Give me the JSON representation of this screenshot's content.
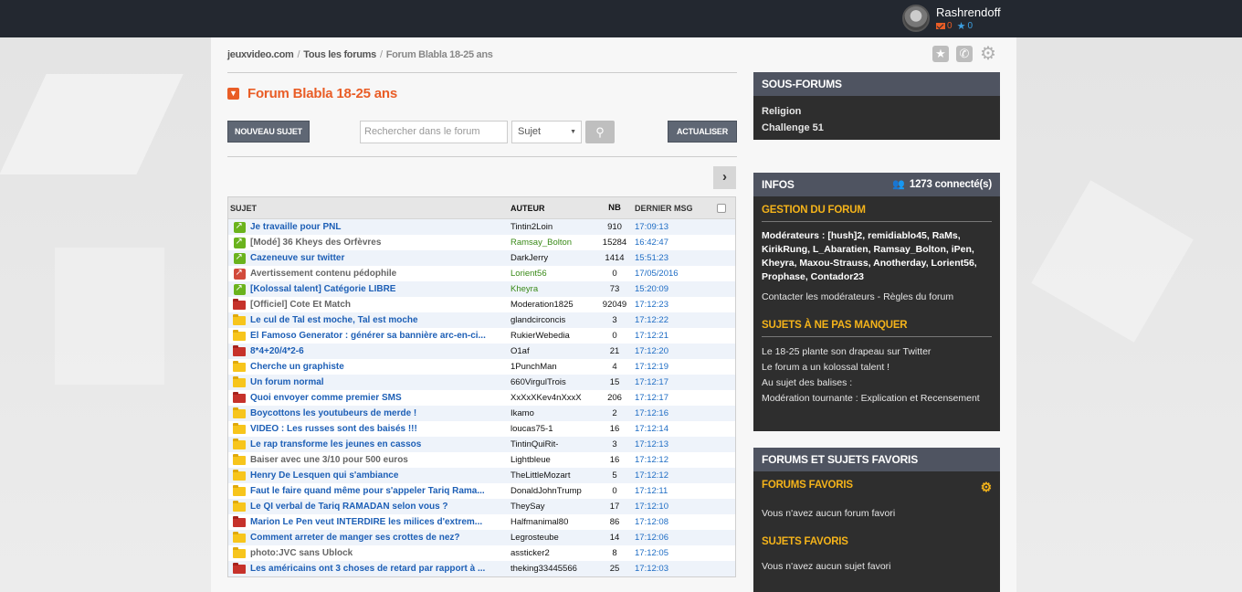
{
  "topbar": {
    "username": "Rashrendoff",
    "mail_count": "0",
    "star_count": "0"
  },
  "breadcrumb": {
    "home": "jeuxvideo.com",
    "all_forums": "Tous les forums",
    "current": "Forum Blabla 18-25 ans"
  },
  "forum": {
    "title": "Forum Blabla 18-25 ans"
  },
  "toolbar": {
    "new_topic_label": "NOUVEAU SUJET",
    "search_placeholder": "Rechercher dans le forum",
    "search_scope": "Sujet",
    "refresh_label": "ACTUALISER"
  },
  "table": {
    "headers": {
      "subject": "SUJET",
      "author": "AUTEUR",
      "count": "NB",
      "last": "DERNIER MSG"
    },
    "rows": [
      {
        "icon": "pin-green",
        "subject": "Je travaille pour PNL",
        "style": "link",
        "author": "Tintin2Loin",
        "author_style": "",
        "nb": "910",
        "last": "17:09:13"
      },
      {
        "icon": "pin-green",
        "subject": "[Modé] 36 Kheys des Orfèvres",
        "style": "grey",
        "author": "Ramsay_Bolton",
        "author_style": "green",
        "nb": "15284",
        "last": "16:42:47"
      },
      {
        "icon": "pin-green",
        "subject": "Cazeneuve sur twitter",
        "style": "link",
        "author": "DarkJerry",
        "author_style": "",
        "nb": "1414",
        "last": "15:51:23"
      },
      {
        "icon": "pin-red",
        "subject": "Avertissement contenu pédophile",
        "style": "grey",
        "author": "Lorient56",
        "author_style": "green",
        "nb": "0",
        "last": "17/05/2016"
      },
      {
        "icon": "pin-green",
        "subject": "[Kolossal talent] Catégorie LIBRE",
        "style": "link",
        "author": "Kheyra",
        "author_style": "green",
        "nb": "73",
        "last": "15:20:09"
      },
      {
        "icon": "folder-r",
        "subject": "[Officiel] Cote Et Match",
        "style": "grey",
        "author": "Moderation1825",
        "author_style": "",
        "nb": "92049",
        "last": "17:12:23"
      },
      {
        "icon": "folder-y",
        "subject": "Le cul de Tal est moche, Tal est moche",
        "style": "link",
        "author": "glandcirconcis",
        "author_style": "",
        "nb": "3",
        "last": "17:12:22"
      },
      {
        "icon": "folder-y",
        "subject": "El Famoso Generator : générer sa bannière arc-en-ci...",
        "style": "link",
        "author": "RukierWebedia",
        "author_style": "",
        "nb": "0",
        "last": "17:12:21"
      },
      {
        "icon": "folder-r",
        "subject": "8*4+20/4*2-6",
        "style": "link",
        "author": "O1af",
        "author_style": "",
        "nb": "21",
        "last": "17:12:20"
      },
      {
        "icon": "folder-y",
        "subject": "Cherche un graphiste",
        "style": "link",
        "author": "1PunchMan",
        "author_style": "",
        "nb": "4",
        "last": "17:12:19"
      },
      {
        "icon": "folder-y",
        "subject": "Un forum normal",
        "style": "link",
        "author": "660VirgulTrois",
        "author_style": "",
        "nb": "15",
        "last": "17:12:17"
      },
      {
        "icon": "folder-r",
        "subject": "Quoi envoyer comme premier SMS",
        "style": "link",
        "author": "XxXxXKev4nXxxX",
        "author_style": "",
        "nb": "206",
        "last": "17:12:17"
      },
      {
        "icon": "folder-y",
        "subject": "Boycottons les youtubeurs de merde !",
        "style": "link",
        "author": "Ikamo",
        "author_style": "",
        "nb": "2",
        "last": "17:12:16"
      },
      {
        "icon": "folder-y",
        "subject": "VIDEO : Les russes sont des baisés !!!",
        "style": "link",
        "author": "loucas75-1",
        "author_style": "",
        "nb": "16",
        "last": "17:12:14"
      },
      {
        "icon": "folder-y",
        "subject": "Le rap transforme les jeunes en cassos",
        "style": "link",
        "author": "TintinQuiRit-",
        "author_style": "",
        "nb": "3",
        "last": "17:12:13"
      },
      {
        "icon": "folder-y",
        "subject": "Baiser avec une 3/10 pour 500 euros",
        "style": "grey",
        "author": "Lightbleue",
        "author_style": "",
        "nb": "16",
        "last": "17:12:12"
      },
      {
        "icon": "folder-y",
        "subject": "Henry De Lesquen qui s'ambiance",
        "style": "link",
        "author": "TheLittleMozart",
        "author_style": "",
        "nb": "5",
        "last": "17:12:12"
      },
      {
        "icon": "folder-y",
        "subject": "Faut le faire quand même pour s'appeler Tariq Rama...",
        "style": "link",
        "author": "DonaldJohnTrump",
        "author_style": "",
        "nb": "0",
        "last": "17:12:11"
      },
      {
        "icon": "folder-y",
        "subject": "Le QI verbal de Tariq RAMADAN selon vous ?",
        "style": "link",
        "author": "TheySay",
        "author_style": "",
        "nb": "17",
        "last": "17:12:10"
      },
      {
        "icon": "folder-r",
        "subject": "Marion Le Pen veut INTERDIRE les milices d'extrem...",
        "style": "link",
        "author": "Halfmanimal80",
        "author_style": "",
        "nb": "86",
        "last": "17:12:08"
      },
      {
        "icon": "folder-y",
        "subject": "Comment arreter de manger ses crottes de nez?",
        "style": "link",
        "author": "Legrosteube",
        "author_style": "",
        "nb": "14",
        "last": "17:12:06"
      },
      {
        "icon": "folder-y",
        "subject": "photo:JVC sans Ublock",
        "style": "grey",
        "author": "assticker2",
        "author_style": "",
        "nb": "8",
        "last": "17:12:05"
      },
      {
        "icon": "folder-r",
        "subject": "Les américains ont 3 choses de retard par rapport à ...",
        "style": "link",
        "author": "theking33445566",
        "author_style": "",
        "nb": "25",
        "last": "17:12:03"
      }
    ]
  },
  "sidebar": {
    "subforums": {
      "title": "SOUS-FORUMS",
      "items": [
        "Religion",
        "Challenge 51"
      ]
    },
    "infos": {
      "title": "INFOS",
      "connected": "1273 connecté(s)",
      "management_title": "GESTION DU FORUM",
      "moderators_label": "Modérateurs :",
      "moderators": "[hush]2, remidiablo45, RaMs, KirikRung, L_Abaratien, Ramsay_Bolton, iPen, Kheyra, Maxou-Strauss, Anotherday, Lorient56, Prophase, Contador23",
      "contact_label": "Contacter les modérateurs",
      "rules_sep": " - ",
      "rules_label": "Règles du forum",
      "musts_title": "SUJETS À NE PAS MANQUER",
      "musts": [
        "Le 18-25 plante son drapeau sur Twitter",
        "Le forum a un kolossal talent !",
        "Au sujet des balises :",
        "Modération tournante : Explication et Recensement"
      ]
    },
    "favorites": {
      "title": "FORUMS ET SUJETS FAVORIS",
      "forums_title": "FORUMS FAVORIS",
      "no_forums": "Vous n'avez aucun forum favori",
      "topics_title": "SUJETS FAVORIS",
      "no_topics": "Vous n'avez aucun sujet favori"
    }
  },
  "colors": {
    "accent_orange": "#e95d26",
    "link_blue": "#1d5fb6",
    "panel_yellow": "#f4b31a",
    "topbar": "#232830"
  }
}
